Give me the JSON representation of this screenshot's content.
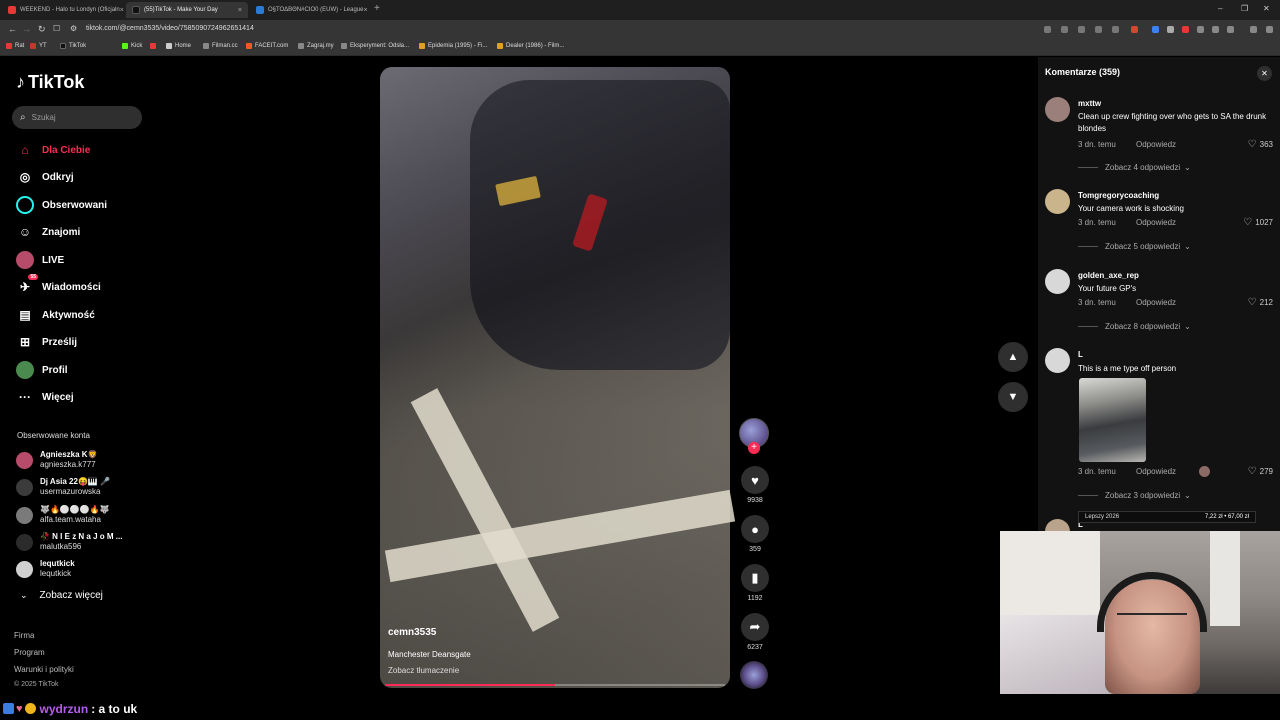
{
  "browser": {
    "tabs": [
      {
        "title": "WEEKEND - Halo tu Londyn (Oficjaln",
        "active": false,
        "color": "#e53935"
      },
      {
        "title": "(55)TikTok - Make Your Day",
        "active": true,
        "color": "#111111"
      },
      {
        "title": "Ο§ΤΟΔΒΘΝ#CIO0 (EUW) - League",
        "active": false,
        "color": "#2a7bd6"
      }
    ],
    "url": "tiktok.com/@cemn3535/video/7585090724962651414",
    "bookmarks": [
      "Rat",
      "YT",
      "TikTok",
      "Kick",
      "",
      "Home",
      "Filman.cc",
      "FACEIT.com",
      "Zagraj.my",
      "Eksperyment: Odsła...",
      "Epidemia (1995) - Fi...",
      "Dealer (1986) - Film..."
    ]
  },
  "tiktok": {
    "logo": "TikTok",
    "search_placeholder": "Szukaj",
    "nav": [
      {
        "label": "Dla Ciebie",
        "icon": "home-icon",
        "active": true
      },
      {
        "label": "Odkryj",
        "icon": "compass-icon",
        "active": false
      },
      {
        "label": "Obserwowani",
        "icon": "following-icon",
        "active": false
      },
      {
        "label": "Znajomi",
        "icon": "friends-icon",
        "active": false
      },
      {
        "label": "LIVE",
        "icon": "live-icon",
        "active": false
      },
      {
        "label": "Wiadomości",
        "icon": "messages-icon",
        "active": false,
        "badge": "55"
      },
      {
        "label": "Aktywność",
        "icon": "activity-icon",
        "active": false
      },
      {
        "label": "Prześlij",
        "icon": "upload-icon",
        "active": false
      },
      {
        "label": "Profil",
        "icon": "profile-icon",
        "active": false
      },
      {
        "label": "Więcej",
        "icon": "more-icon",
        "active": false
      }
    ],
    "followed_title": "Obserwowane konta",
    "followed": [
      {
        "name": "Agnieszka K🦁",
        "handle": "agnieszka.k777",
        "color": "#b74b6a"
      },
      {
        "name": "Dj Asia 22😝🎹 🎤",
        "handle": "usermazurowska",
        "color": "#3b3b3b"
      },
      {
        "name": "🐺🔥⚪⚪⚪🔥🐺",
        "handle": "alfa.team.wataha",
        "color": "#7a7a7a"
      },
      {
        "name": "🥀 N I E z N a J o M ...",
        "handle": "malutka596",
        "color": "#2b2b2b"
      },
      {
        "name": "lequtkick",
        "handle": "lequtkick",
        "color": "#d0d0d0"
      }
    ],
    "see_more": "Zobacz więcej",
    "footer": [
      "Firma",
      "Program",
      "Warunki i polityki"
    ],
    "copyright": "© 2025 TikTok"
  },
  "video": {
    "username": "cemn3535",
    "description": "Manchester Deansgate",
    "translate": "Zobacz tłumaczenie",
    "progress": 0.5,
    "likes": "9938",
    "comments": "359",
    "saves": "1192",
    "shares": "6237"
  },
  "comments_panel": {
    "title": "Komentarze (359)",
    "items": [
      {
        "user": "mxttw",
        "text": "Clean up crew fighting over who gets to SA the drunk blondes",
        "time": "3 dn. temu",
        "reply": "Odpowiedz",
        "likes": "363",
        "more": "Zobacz 4 odpowiedzi",
        "avatar": "#9a7f7a"
      },
      {
        "user": "Tomgregorycoaching",
        "text": "Your camera work is shocking",
        "time": "3 dn. temu",
        "reply": "Odpowiedz",
        "likes": "1027",
        "more": "Zobacz 5 odpowiedzi",
        "avatar": "#c9b48c"
      },
      {
        "user": "golden_axe_rep",
        "text": "Your future GP's",
        "time": "3 dn. temu",
        "reply": "Odpowiedz",
        "likes": "212",
        "more": "Zobacz 8 odpowiedzi",
        "avatar": "#d8d8d8"
      },
      {
        "user": "L",
        "text": "This is a me type off person",
        "time": "3 dn. temu",
        "reply": "Odpowiedz",
        "likes": "279",
        "more": "Zobacz 3 odpowiedzi",
        "avatar": "#d8d8d8"
      }
    ],
    "next_user": "L"
  },
  "stream": {
    "ticker_label": "Lepszy 2026",
    "ticker_value": "7,22 zł • 67,00 zł",
    "chat_user": "wydrzun",
    "chat_msg": ": a to uk"
  },
  "colors": {
    "accent": "#fe2c55",
    "background": "#000000",
    "panel": "#121212"
  }
}
